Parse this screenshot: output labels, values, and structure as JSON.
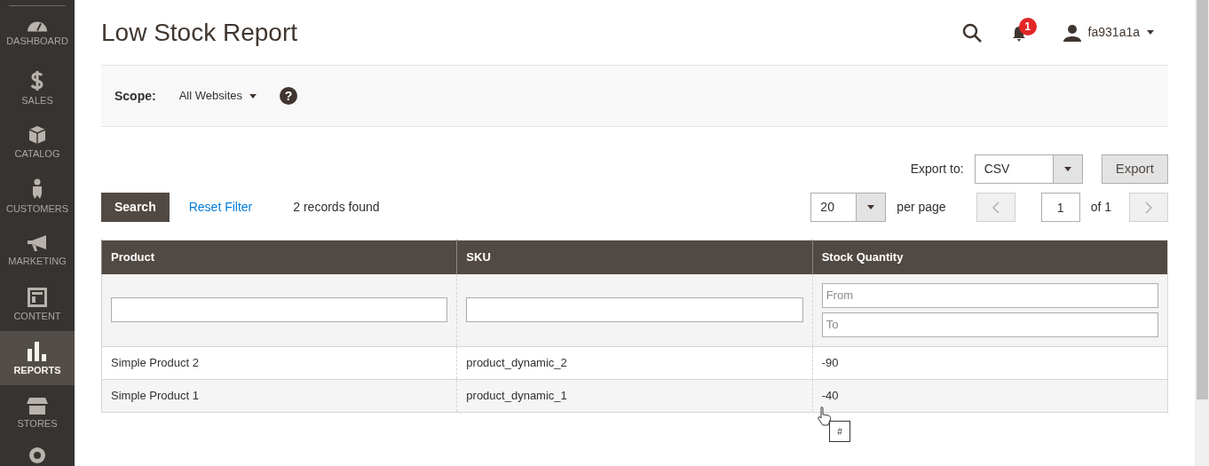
{
  "sidebar": {
    "items": [
      {
        "kind": "dashboard",
        "label": "DASHBOARD",
        "selected": false
      },
      {
        "kind": "sales",
        "label": "SALES",
        "selected": false
      },
      {
        "kind": "catalog",
        "label": "CATALOG",
        "selected": false
      },
      {
        "kind": "customers",
        "label": "CUSTOMERS",
        "selected": false
      },
      {
        "kind": "marketing",
        "label": "MARKETING",
        "selected": false
      },
      {
        "kind": "content",
        "label": "CONTENT",
        "selected": false
      },
      {
        "kind": "reports",
        "label": "REPORTS",
        "selected": true
      },
      {
        "kind": "stores",
        "label": "STORES",
        "selected": false
      }
    ]
  },
  "header": {
    "title": "Low Stock Report",
    "notification_count": "1",
    "user": "fa931a1a"
  },
  "scope": {
    "label": "Scope:",
    "value": "All Websites",
    "help": "?"
  },
  "export": {
    "label": "Export to:",
    "format": "CSV",
    "button": "Export"
  },
  "toolbar": {
    "search": "Search",
    "reset": "Reset Filter",
    "records": "2 records found",
    "per_page": "20",
    "per_page_label": "per page",
    "page": "1",
    "of": "of 1"
  },
  "table": {
    "columns": [
      "Product",
      "SKU",
      "Stock Quantity"
    ],
    "filters": [
      {
        "kind": "text"
      },
      {
        "kind": "text"
      },
      {
        "kind": "range",
        "placeholders": [
          "From",
          "To"
        ]
      }
    ],
    "rows": [
      [
        "Simple Product 2",
        "product_dynamic_2",
        "-90"
      ],
      [
        "Simple Product 1",
        "product_dynamic_1",
        "-40"
      ]
    ]
  },
  "tooltip": "#"
}
